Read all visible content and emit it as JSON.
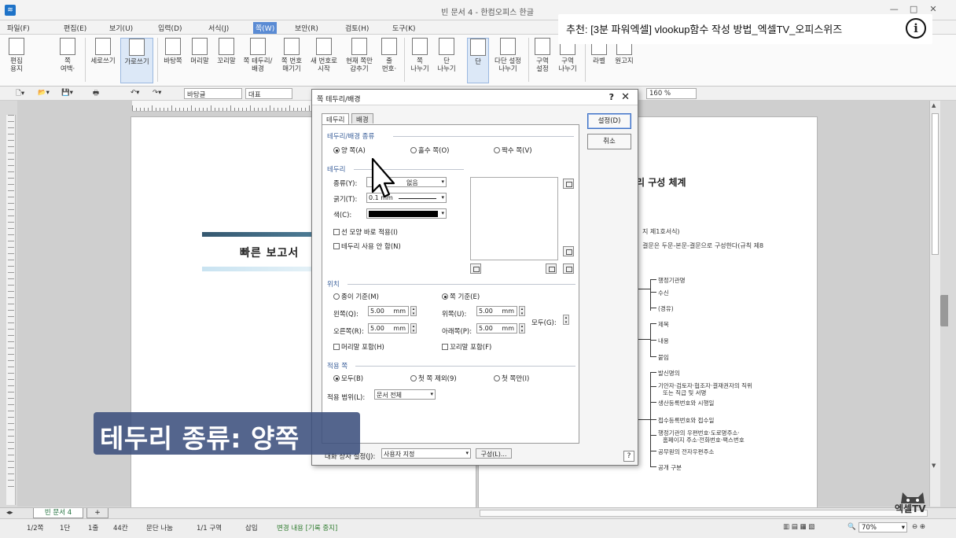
{
  "window": {
    "title": "빈 문서 4 - 한컴오피스 한글",
    "controls": [
      "—",
      "□",
      "✕"
    ]
  },
  "menu": {
    "items": [
      "파일(F)",
      "편집(E)",
      "보기(U)",
      "입력(D)",
      "서식(J)",
      "쪽(W)",
      "보안(R)",
      "검토(H)",
      "도구(K)"
    ],
    "active_index": 5
  },
  "recommendation": {
    "text": "추천: [3분 파워엑셀] vlookup함수 작성 방법_엑셀TV_오피스위즈",
    "icon": "info-icon"
  },
  "ribbon": {
    "buttons": [
      "편집\n용지",
      "쪽\n여백·",
      "세로쓰기",
      "가로쓰기",
      "바탕쪽",
      "머리말",
      "꼬리말",
      "쪽 테두리/\n배경",
      "쪽 번호\n매기기",
      "새 번호로\n시작",
      "현재 쪽만\n감추기",
      "줄\n번호·",
      "쪽\n나누기",
      "단\n나누기",
      "단",
      "다단 설정\n나누기",
      "구역\n설정",
      "구역\n나누기",
      "라벨",
      "원고지"
    ]
  },
  "toolbar": {
    "style_box": "바탕글",
    "font_box": "대표",
    "zoom_value": "160",
    "zoom_unit": "%"
  },
  "document": {
    "left_title": "빠른 보고서",
    "right_title": "리 구성 체계",
    "right_line1": "지 제1호서식)",
    "right_line2": "결문은 두문-본문-결문으로 구성한다(규칙 제8",
    "tree_items": [
      "행정기관명",
      "수신",
      "(경유)",
      "제목",
      "내용",
      "붙임",
      "발신명의",
      "기안자·검토자·협조자·결재권자의 직위",
      "또는 직급 및 서명",
      "생산등록번호와 시행일",
      "접수등록번호와 접수일",
      "행정기관의 우편번호·도로명주소·",
      "홈페이지 주소·전화번호·팩스번호",
      "공무원의 전자우편주소",
      "공개 구분"
    ]
  },
  "dialog": {
    "title": "쪽 테두리/배경",
    "help": "?",
    "close": "✕",
    "tabs": [
      "테두리",
      "배경"
    ],
    "section_type": "테두리/배경 종류",
    "types": [
      "양 쪽(A)",
      "홀수 쪽(O)",
      "짝수 쪽(V)"
    ],
    "section_border": "테두리",
    "border_kind_label": "종류(Y):",
    "border_kind_value": "없음",
    "thickness_label": "굵기(T):",
    "thickness_value": "0.1 mm",
    "color_label": "색(C):",
    "chk_line_shape": "선 모양 바로 적용(I)",
    "chk_no_border": "테두리 사용 안 함(N)",
    "section_position": "위치",
    "pos_paper": "종이 기준(M)",
    "pos_page": "쪽 기준(E)",
    "left_label": "왼쪽(Q):",
    "right_label": "오른쪽(R):",
    "top_label": "위쪽(U):",
    "bottom_label": "아래쪽(P):",
    "all_label": "모두(G):",
    "margin_value": "5.00",
    "unit": "mm",
    "chk_header": "머리말 포함(H)",
    "chk_footer": "꼬리말 포함(F)",
    "section_apply": "적용 쪽",
    "apply_all": "모두(B)",
    "apply_except_first": "첫 쪽 제외(9)",
    "apply_first_only": "첫 쪽만(I)",
    "range_label": "적용 범위(L):",
    "range_value": "문서 전체",
    "preset_label": "대화 상자 설정(J):",
    "preset_value": "사용자 지정",
    "compose_btn": "구성(L)...",
    "ok_btn": "설정(D)",
    "cancel_btn": "취소"
  },
  "caption": {
    "text": "테두리 종류: 양쪽"
  },
  "sheet": {
    "tab": "빈 문서 4",
    "add": "+"
  },
  "status": {
    "page": "1/2쪽",
    "column": "1단",
    "line": "1줄",
    "col_pos": "44칸",
    "para": "문단 나눔",
    "section": "1/1 구역",
    "mode": "삽입",
    "track": "변경 내용 [기록 중지]",
    "zoom": "70%"
  },
  "watermark": {
    "text": "엑셀TV"
  }
}
